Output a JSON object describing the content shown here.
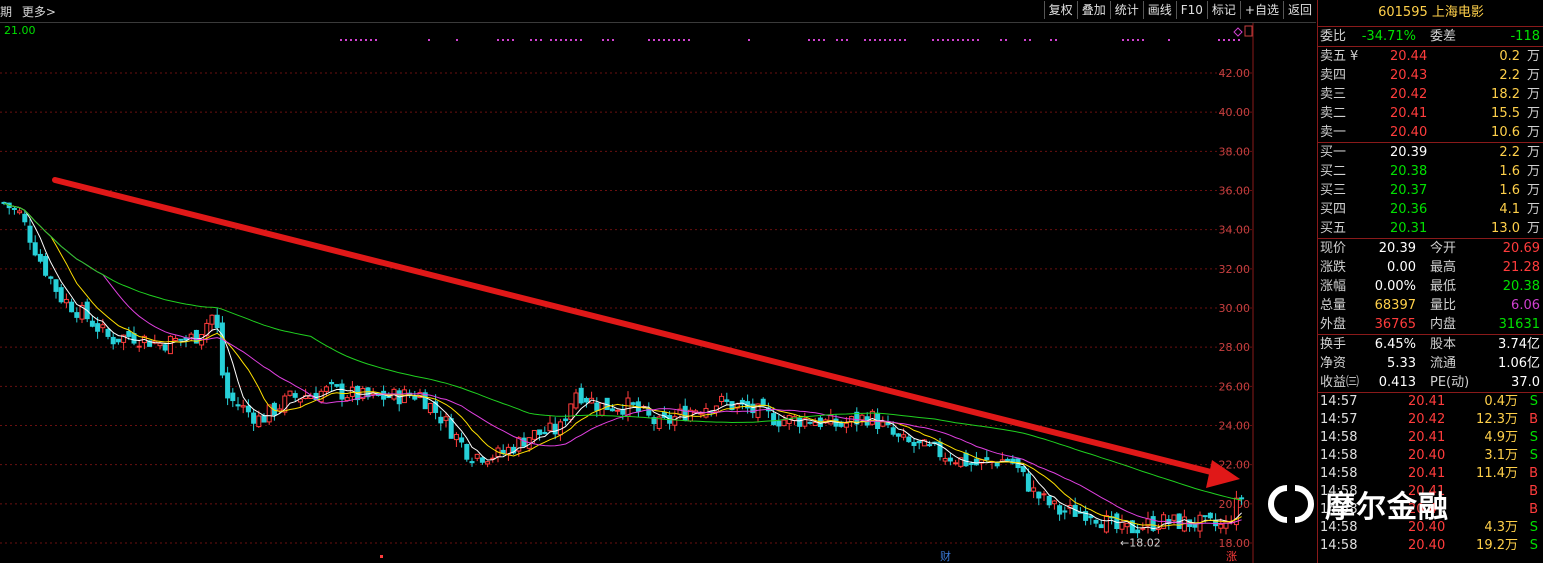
{
  "toolbar": {
    "period": "期",
    "more": "更多>",
    "buttons": [
      "复权",
      "叠加",
      "统计",
      "画线",
      "F10",
      "标记",
      "+自选",
      "返回"
    ]
  },
  "chart": {
    "top_left_price": "21.00",
    "y_ticks": [
      "42.00",
      "40.00",
      "38.00",
      "36.00",
      "34.00",
      "32.00",
      "30.00",
      "28.00",
      "26.00",
      "24.00",
      "22.00",
      "20.00",
      "18.00"
    ],
    "low_label": "←18.02",
    "bottom_marks": [
      "财",
      "涨"
    ],
    "colors": {
      "up": "#ff3c3c",
      "down": "#27d0d8",
      "ma5": "#ffffff",
      "ma10": "#ffe000",
      "ma20": "#e040e0",
      "ma60": "#20d020",
      "arrow": "#e01818"
    }
  },
  "panel": {
    "title": "601595 上海电影",
    "wei_bi_label": "委比",
    "wei_bi": "-34.71%",
    "wei_cha_label": "委差",
    "wei_cha": "-118",
    "unit": "万",
    "asks": [
      {
        "label": "卖五",
        "price": "20.44",
        "vol": "0.2"
      },
      {
        "label": "卖四",
        "price": "20.43",
        "vol": "2.2"
      },
      {
        "label": "卖三",
        "price": "20.42",
        "vol": "18.2"
      },
      {
        "label": "卖二",
        "price": "20.41",
        "vol": "15.5"
      },
      {
        "label": "卖一",
        "price": "20.40",
        "vol": "10.6"
      }
    ],
    "ask5_mark": "¥",
    "bids": [
      {
        "label": "买一",
        "price": "20.39",
        "vol": "2.2"
      },
      {
        "label": "买二",
        "price": "20.38",
        "vol": "1.6"
      },
      {
        "label": "买三",
        "price": "20.37",
        "vol": "1.6"
      },
      {
        "label": "买四",
        "price": "20.36",
        "vol": "4.1"
      },
      {
        "label": "买五",
        "price": "20.31",
        "vol": "13.0"
      }
    ],
    "stats": [
      {
        "l1": "现价",
        "v1": "20.39",
        "l2": "今开",
        "v2": "20.69"
      },
      {
        "l1": "涨跌",
        "v1": "0.00",
        "l2": "最高",
        "v2": "21.28"
      },
      {
        "l1": "涨幅",
        "v1": "0.00%",
        "l2": "最低",
        "v2": "20.38"
      },
      {
        "l1": "总量",
        "v1": "68397",
        "l2": "量比",
        "v2": "6.06"
      },
      {
        "l1": "外盘",
        "v1": "36765",
        "l2": "内盘",
        "v2": "31631"
      }
    ],
    "stats2": [
      {
        "l1": "换手",
        "v1": "6.45%",
        "l2": "股本",
        "v2": "3.74亿"
      },
      {
        "l1": "净资",
        "v1": "5.33",
        "l2": "流通",
        "v2": "1.06亿"
      },
      {
        "l1": "收益㈢",
        "v1": "0.413",
        "l2": "PE(动)",
        "v2": "37.0"
      }
    ],
    "ticks": [
      {
        "time": "14:57",
        "price": "20.41",
        "vol": "0.4万",
        "dir": "S"
      },
      {
        "time": "14:57",
        "price": "20.42",
        "vol": "12.3万",
        "dir": "B"
      },
      {
        "time": "14:58",
        "price": "20.41",
        "vol": "4.9万",
        "dir": "S"
      },
      {
        "time": "14:58",
        "price": "20.40",
        "vol": "3.1万",
        "dir": "S"
      },
      {
        "time": "14:58",
        "price": "20.41",
        "vol": "11.4万",
        "dir": "B"
      },
      {
        "time": "14:58",
        "price": "20.41",
        "vol": "",
        "dir": "B"
      },
      {
        "time": "14:58",
        "price": "20.4",
        "vol": "",
        "dir": "B"
      },
      {
        "time": "14:58",
        "price": "20.40",
        "vol": "4.3万",
        "dir": "S"
      },
      {
        "time": "14:58",
        "price": "20.40",
        "vol": "19.2万",
        "dir": "S"
      }
    ]
  },
  "watermark": {
    "text": "摩尔金融"
  }
}
